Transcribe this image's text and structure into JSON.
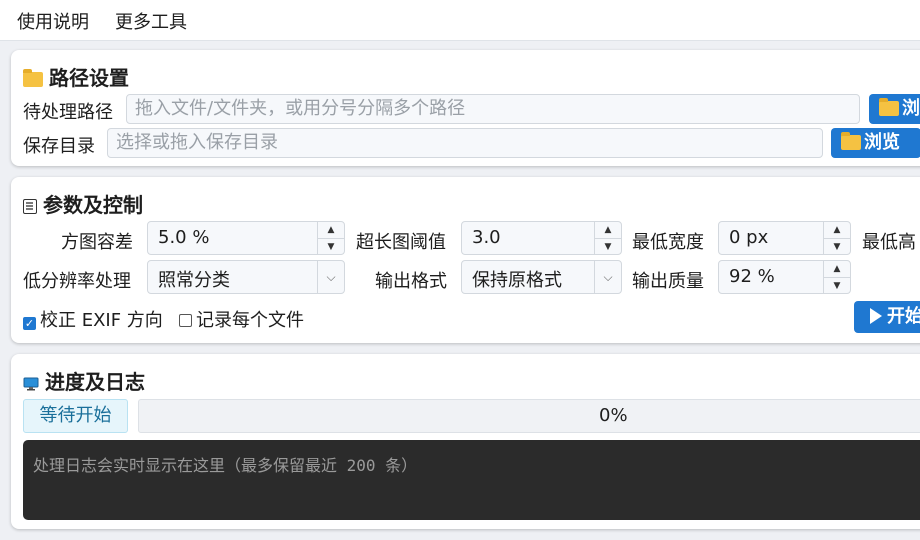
{
  "menu": {
    "items": [
      "使用说明",
      "更多工具"
    ]
  },
  "path_section": {
    "title": "路径设置",
    "title_icon": "folder-icon",
    "input_label": "待处理路径",
    "input_placeholder": "拖入文件/文件夹，或用分号分隔多个路径",
    "input_browse": "浏",
    "output_label": "保存目录",
    "output_placeholder": "选择或拖入保存目录",
    "output_browse": "浏览"
  },
  "params_section": {
    "title": "参数及控制",
    "title_icon": "list-icon",
    "tolerance_label": "方图容差",
    "tolerance_value": "5.0 %",
    "long_threshold_label": "超长图阈值",
    "long_threshold_value": "3.0",
    "min_width_label": "最低宽度",
    "min_width_value": "0 px",
    "min_height_label": "最低高",
    "lowres_label": "低分辨率处理",
    "lowres_value": "照常分类",
    "format_label": "输出格式",
    "format_value": "保持原格式",
    "quality_label": "输出质量",
    "quality_value": "92 %",
    "exif_label": "校正 EXIF 方向",
    "exif_checked": true,
    "record_label": "记录每个文件",
    "record_checked": false,
    "start_label": "开始",
    "start_icon": "play-icon"
  },
  "progress_section": {
    "title": "进度及日志",
    "title_icon": "monitor-icon",
    "status": "等待开始",
    "progress_text": "0%",
    "progress_value": 0,
    "log_placeholder": "处理日志会实时显示在这里（最多保留最近 200 条）"
  },
  "colors": {
    "accent": "#1f78d1",
    "background": "#eef0f4",
    "log_bg": "#2b2b2b"
  }
}
